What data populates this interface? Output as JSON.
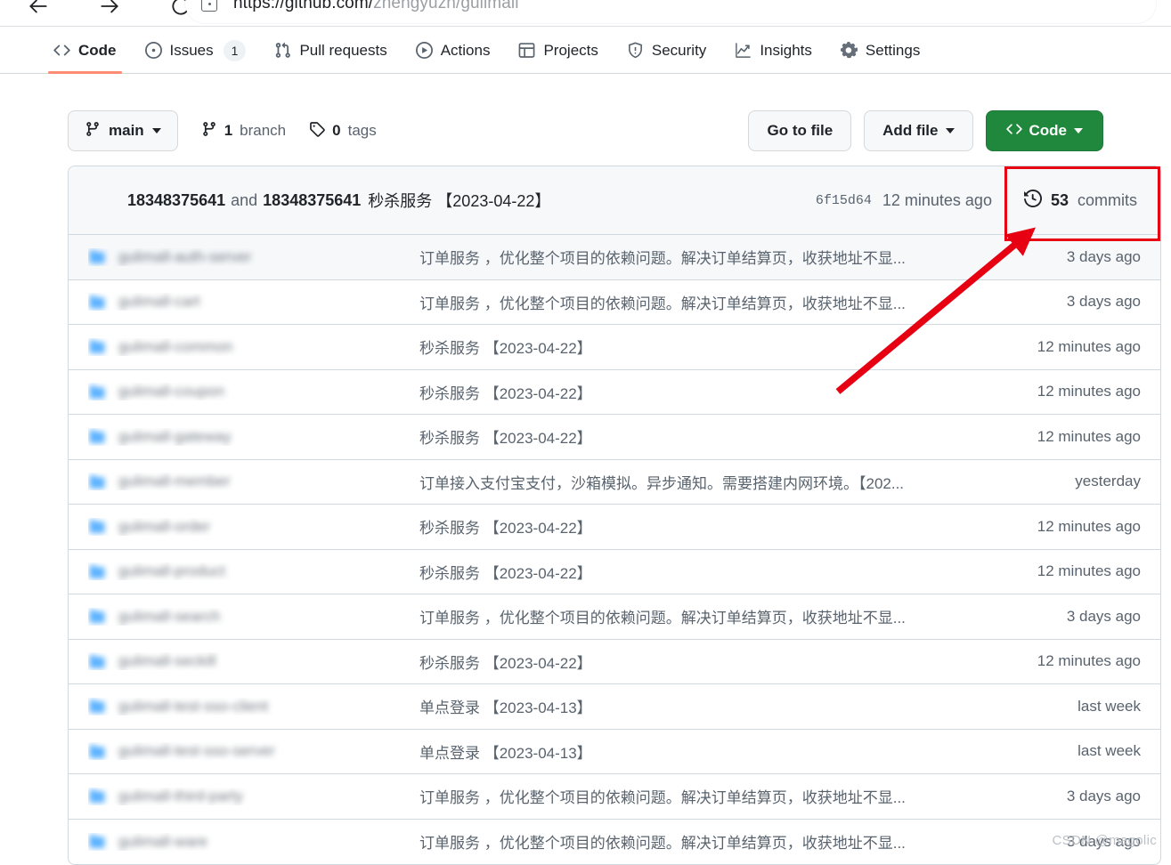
{
  "browser": {
    "back_icon": "arrow-left-icon",
    "forward_icon": "arrow-right-icon",
    "reload_icon": "reload-icon",
    "url_prefix": "https://github.com/",
    "url_path": "zhengyuzh/gulimall",
    "url_full": "https://github.com/zhengyuzh/gulimall"
  },
  "repo_nav": {
    "tabs": [
      {
        "label": "Code",
        "icon": "code-icon",
        "selected": true,
        "count": ""
      },
      {
        "label": "Issues",
        "icon": "issue-opened-icon",
        "selected": false,
        "count": "1"
      },
      {
        "label": "Pull requests",
        "icon": "git-pull-request-icon",
        "selected": false,
        "count": ""
      },
      {
        "label": "Actions",
        "icon": "play-icon",
        "selected": false,
        "count": ""
      },
      {
        "label": "Projects",
        "icon": "table-icon",
        "selected": false,
        "count": ""
      },
      {
        "label": "Security",
        "icon": "shield-icon",
        "selected": false,
        "count": ""
      },
      {
        "label": "Insights",
        "icon": "graph-icon",
        "selected": false,
        "count": ""
      },
      {
        "label": "Settings",
        "icon": "gear-icon",
        "selected": false,
        "count": ""
      }
    ]
  },
  "toolbar": {
    "branch_name": "main",
    "branch_icon": "git-branch-icon",
    "branch_count": "1",
    "branch_count_label": "branch",
    "tag_count": "0",
    "tag_count_label": "tags",
    "tag_icon": "tag-icon",
    "go_to_file_label": "Go to file",
    "add_file_label": "Add file",
    "code_label": "Code",
    "code_icon": "code-icon"
  },
  "commit_bar": {
    "author": "18348375641",
    "and_text": "and",
    "coauthor": "18348375641",
    "message": "秒杀服务 【2023-04-22】",
    "sha": "6f15d64",
    "time": "12 minutes ago",
    "commits_count": "53",
    "commits_label": "commits",
    "history_icon": "history-icon"
  },
  "file_rows": [
    {
      "name": "gulimall-auth-server",
      "icon": "folder-icon",
      "message": "订单服务 ，优化整个项目的依赖问题。解决订单结算页，收获地址不显...",
      "time": "3 days ago"
    },
    {
      "name": "gulimall-cart",
      "icon": "folder-icon",
      "message": "订单服务 ，优化整个项目的依赖问题。解决订单结算页，收获地址不显...",
      "time": "3 days ago"
    },
    {
      "name": "gulimall-common",
      "icon": "folder-icon",
      "message": "秒杀服务 【2023-04-22】",
      "time": "12 minutes ago"
    },
    {
      "name": "gulimall-coupon",
      "icon": "folder-icon",
      "message": "秒杀服务 【2023-04-22】",
      "time": "12 minutes ago"
    },
    {
      "name": "gulimall-gateway",
      "icon": "folder-icon",
      "message": "秒杀服务 【2023-04-22】",
      "time": "12 minutes ago"
    },
    {
      "name": "gulimall-member",
      "icon": "folder-icon",
      "message": "订单接入支付宝支付，沙箱模拟。异步通知。需要搭建内网环境。【202...",
      "time": "yesterday"
    },
    {
      "name": "gulimall-order",
      "icon": "folder-icon",
      "message": "秒杀服务 【2023-04-22】",
      "time": "12 minutes ago"
    },
    {
      "name": "gulimall-product",
      "icon": "folder-icon",
      "message": "秒杀服务 【2023-04-22】",
      "time": "12 minutes ago"
    },
    {
      "name": "gulimall-search",
      "icon": "folder-icon",
      "message": "订单服务 ，优化整个项目的依赖问题。解决订单结算页，收获地址不显...",
      "time": "3 days ago"
    },
    {
      "name": "gulimall-seckill",
      "icon": "folder-icon",
      "message": "秒杀服务 【2023-04-22】",
      "time": "12 minutes ago"
    },
    {
      "name": "gulimall-test-sso-client",
      "icon": "folder-icon",
      "message": "单点登录 【2023-04-13】",
      "time": "last week"
    },
    {
      "name": "gulimall-test-sso-server",
      "icon": "folder-icon",
      "message": "单点登录 【2023-04-13】",
      "time": "last week"
    },
    {
      "name": "gulimall-third-party",
      "icon": "folder-icon",
      "message": "订单服务 ，优化整个项目的依赖问题。解决订单结算页，收获地址不显...",
      "time": "3 days ago"
    },
    {
      "name": "gulimall-ware",
      "icon": "folder-icon",
      "message": "订单服务 ，优化整个项目的依赖问题。解决订单结算页，收获地址不显...",
      "time": "3 days ago"
    }
  ],
  "annotations": {
    "highlight_color": "#e60012",
    "box_target": "53 commits",
    "arrow_icon": "arrow-annotation-icon"
  },
  "watermark": {
    "text": "CSDN @magolic"
  }
}
